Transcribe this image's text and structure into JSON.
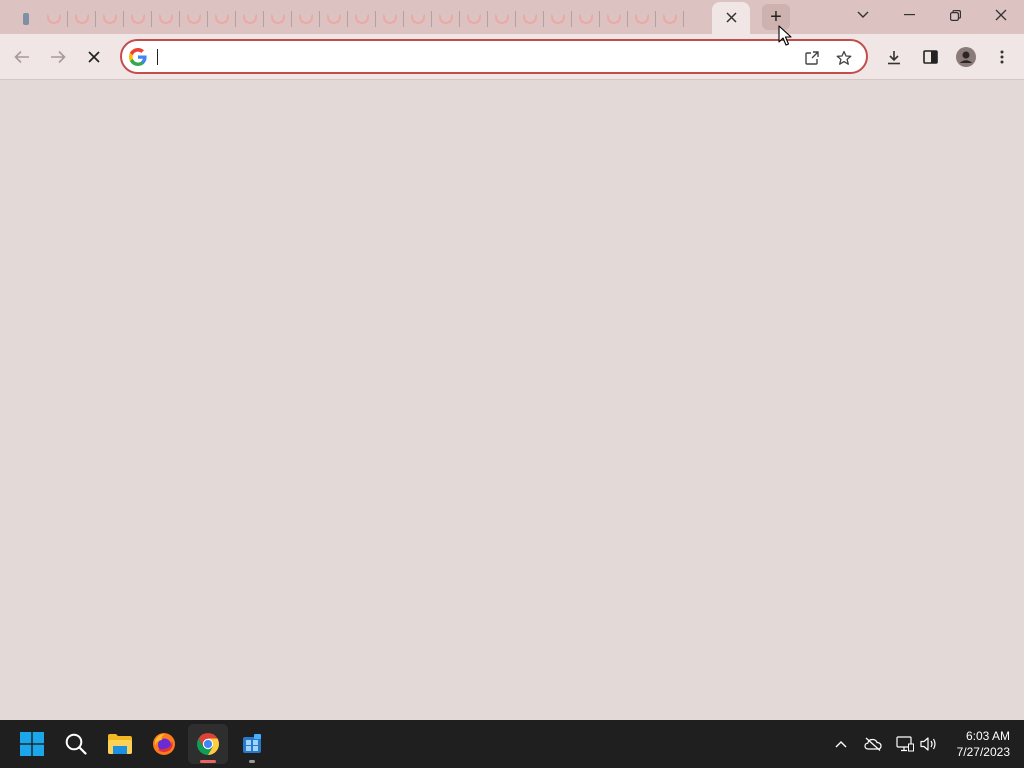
{
  "browser": {
    "tabstrip": {
      "background_tab_count": 24,
      "active_tab": {
        "close_icon": "close-icon"
      },
      "new_tab_label": "+",
      "window_controls": [
        "chevron-down-icon",
        "minimize-icon",
        "restore-icon",
        "close-icon"
      ]
    },
    "toolbar": {
      "back_icon": "arrow-left-icon",
      "forward_icon": "arrow-right-icon",
      "stop_icon": "close-icon",
      "omnibox": {
        "value": "",
        "search_engine_icon": "google-g-icon"
      },
      "omnibox_actions": [
        "share-icon",
        "star-icon"
      ],
      "actions": [
        "download-icon",
        "side-panel-icon",
        "profile-icon",
        "more-vert-icon"
      ]
    },
    "colors": {
      "accent": "#c24d4b",
      "tabstrip": "#dcc3c1",
      "toolbar": "#efe6e5",
      "content": "#e3dad8"
    }
  },
  "taskbar": {
    "apps": [
      "windows-start-icon",
      "search-icon",
      "file-explorer-icon",
      "firefox-icon",
      "chrome-icon",
      "app-icon"
    ],
    "active_app": "chrome-icon",
    "tray_icons": [
      "chevron-up-icon",
      "onedrive-offline-icon",
      "network-icon",
      "volume-icon"
    ],
    "time": "6:03 AM",
    "date": "7/27/2023"
  }
}
